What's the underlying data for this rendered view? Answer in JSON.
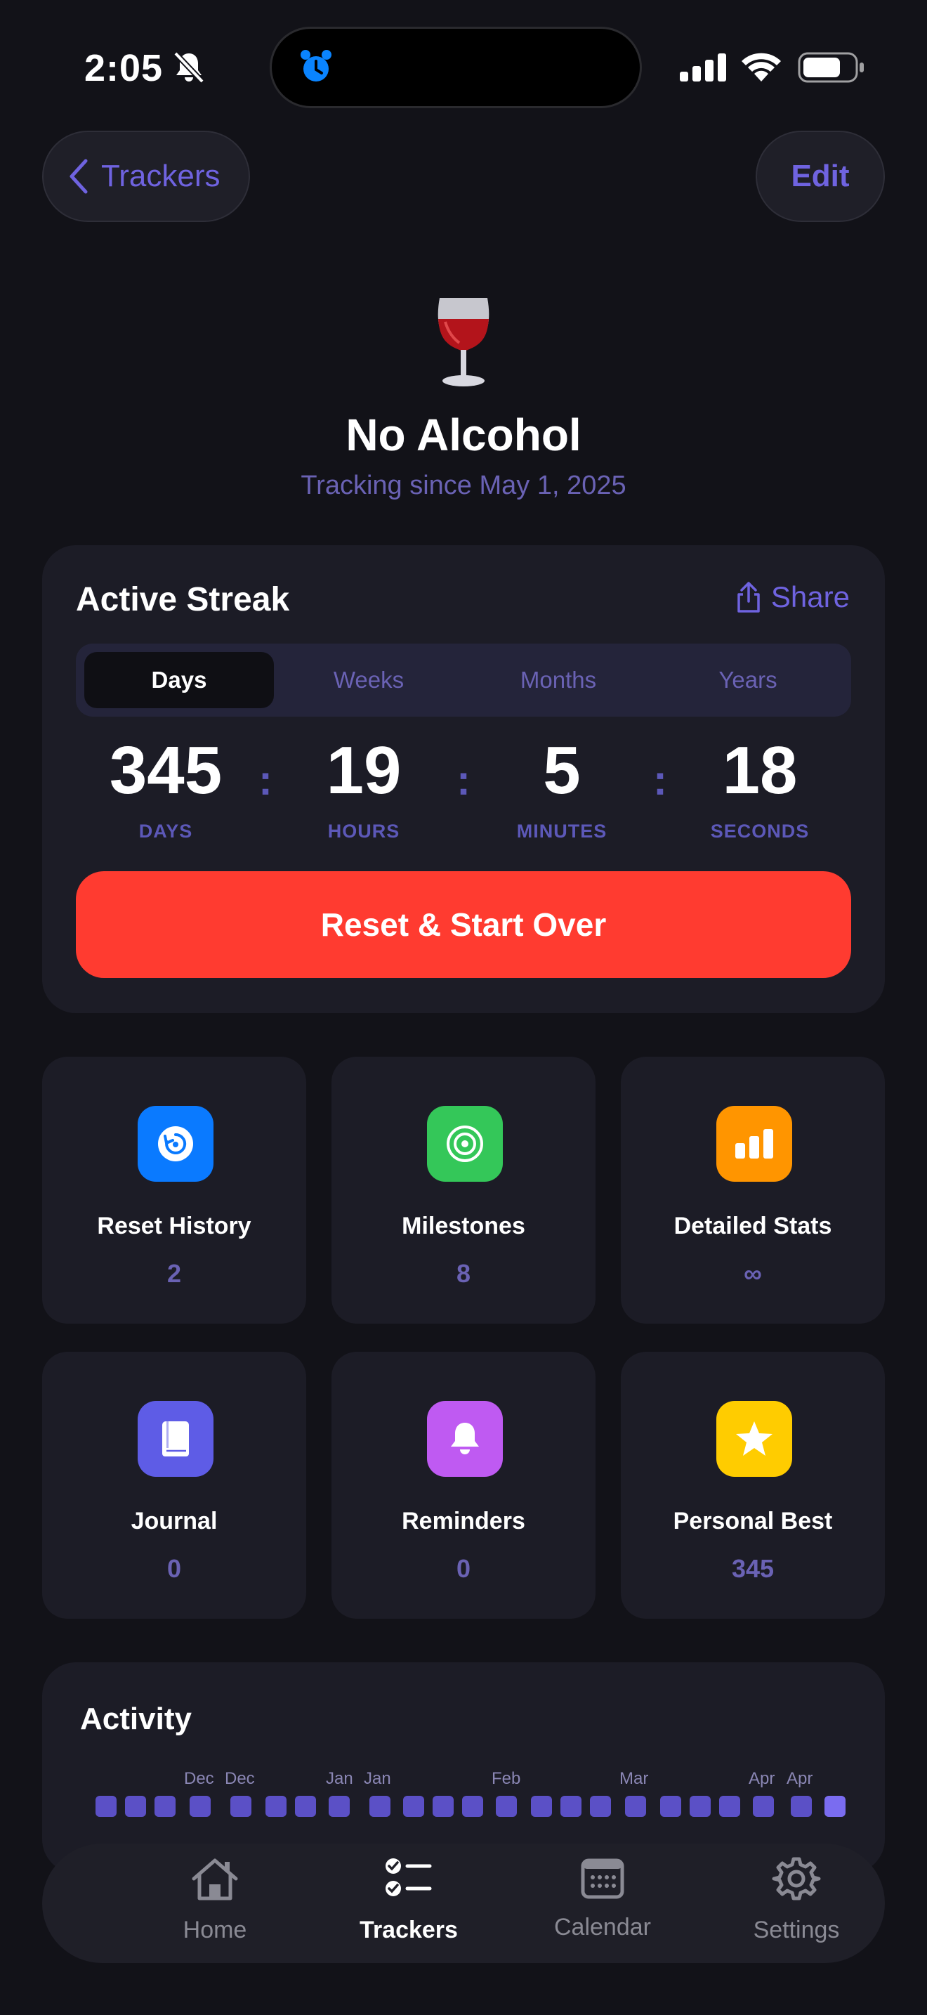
{
  "status_bar": {
    "time": "2:05"
  },
  "nav": {
    "back_label": "Trackers",
    "edit_label": "Edit"
  },
  "header": {
    "title": "No Alcohol",
    "subtitle": "Tracking since May 1, 2025",
    "icon": "wine-glass-icon"
  },
  "streak": {
    "title": "Active Streak",
    "share_label": "Share",
    "segments": [
      "Days",
      "Weeks",
      "Months",
      "Years"
    ],
    "selected_segment": "Days",
    "counters": [
      {
        "value": "345",
        "unit": "DAYS"
      },
      {
        "value": "19",
        "unit": "HOURS"
      },
      {
        "value": "5",
        "unit": "MINUTES"
      },
      {
        "value": "18",
        "unit": "SECONDS"
      }
    ],
    "separator": ":",
    "reset_label": "Reset & Start Over"
  },
  "tiles": [
    {
      "label": "Reset History",
      "value": "2",
      "icon": "reset-icon",
      "color": "#0a7aff"
    },
    {
      "label": "Milestones",
      "value": "8",
      "icon": "target-icon",
      "color": "#34c759"
    },
    {
      "label": "Detailed Stats",
      "value": "∞",
      "icon": "chart-icon",
      "color": "#ff9500"
    },
    {
      "label": "Journal",
      "value": "0",
      "icon": "book-icon",
      "color": "#5e5ce6"
    },
    {
      "label": "Reminders",
      "value": "0",
      "icon": "bell-icon",
      "color": "#bf5af2"
    },
    {
      "label": "Personal Best",
      "value": "345",
      "icon": "star-icon",
      "color": "#ffcc00"
    }
  ],
  "activity": {
    "title": "Activity",
    "month_labels": [
      "Dec",
      "Dec",
      "Jan",
      "Jan",
      "Feb",
      "Mar",
      "Apr",
      "Apr"
    ]
  },
  "tabbar": {
    "tabs": [
      {
        "label": "Home",
        "icon": "house-icon"
      },
      {
        "label": "Trackers",
        "icon": "checklist-icon"
      },
      {
        "label": "Calendar",
        "icon": "calendar-icon"
      },
      {
        "label": "Settings",
        "icon": "gear-icon"
      }
    ],
    "active": "Trackers"
  },
  "colors": {
    "accent": "#6f63e0",
    "danger": "#ff3b30",
    "background": "#121218",
    "card": "#1c1c26"
  }
}
